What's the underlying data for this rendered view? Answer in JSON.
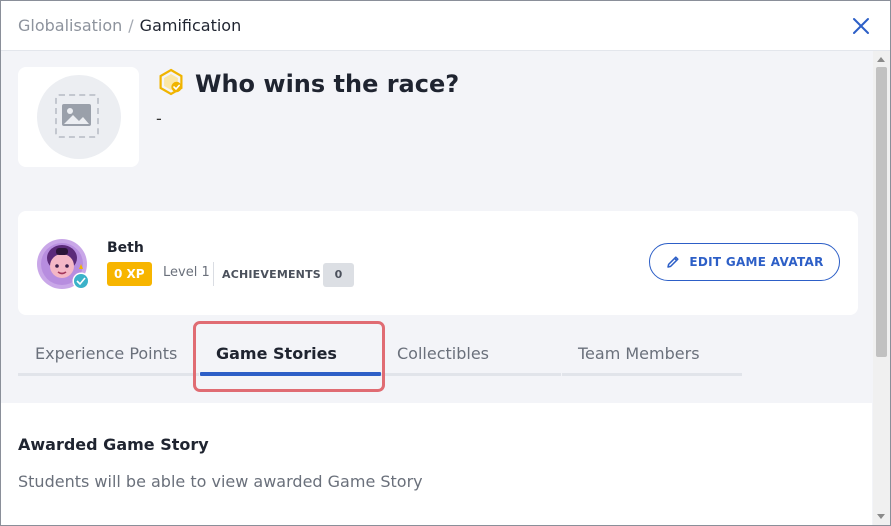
{
  "breadcrumb": {
    "parent": "Globalisation",
    "separator": "/",
    "current": "Gamification"
  },
  "game": {
    "title": "Who wins the race?",
    "description": "-",
    "title_icon": "gold-badge-check-icon",
    "image_icon": "image-placeholder-icon"
  },
  "player": {
    "name": "Beth",
    "xp": "0 XP",
    "level": "Level 1",
    "achievements_label": "ACHIEVEMENTS",
    "achievements_count": "0",
    "edit_button_label": "EDIT GAME AVATAR"
  },
  "tabs": [
    {
      "label": "Experience Points",
      "active": false
    },
    {
      "label": "Game Stories",
      "active": true
    },
    {
      "label": "Collectibles",
      "active": false
    },
    {
      "label": "Team Members",
      "active": false
    }
  ],
  "content": {
    "section_title": "Awarded Game Story",
    "section_description": "Students will be able to view awarded Game Story"
  },
  "colors": {
    "accent": "#2d5fc7",
    "xp_badge": "#f7b500",
    "highlight": "#e06c73"
  }
}
